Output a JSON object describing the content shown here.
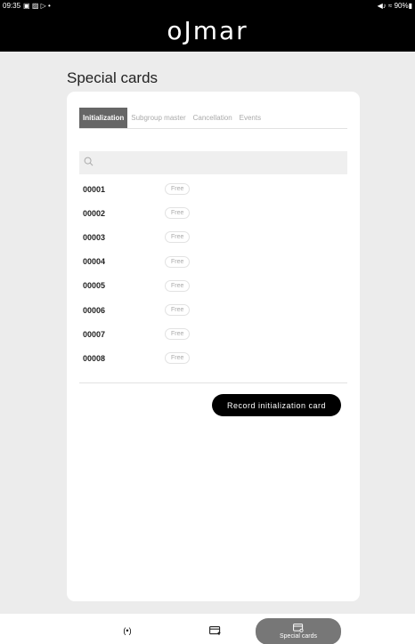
{
  "status_bar": {
    "time": "09:35",
    "left_icons": "▣ ▨ ▷ •",
    "right_text": "◀♪ ≈ 90%▮"
  },
  "brand": {
    "logo_text": "oJmar"
  },
  "page": {
    "title": "Special cards"
  },
  "tabs": [
    {
      "label": "Initialization",
      "active": true
    },
    {
      "label": "Subgroup master",
      "active": false
    },
    {
      "label": "Cancellation",
      "active": false
    },
    {
      "label": "Events",
      "active": false
    }
  ],
  "search": {
    "placeholder": "",
    "value": ""
  },
  "cards": [
    {
      "code": "00001",
      "status": "Free"
    },
    {
      "code": "00002",
      "status": "Free"
    },
    {
      "code": "00003",
      "status": "Free"
    },
    {
      "code": "00004",
      "status": "Free"
    },
    {
      "code": "00005",
      "status": "Free"
    },
    {
      "code": "00006",
      "status": "Free"
    },
    {
      "code": "00007",
      "status": "Free"
    },
    {
      "code": "00008",
      "status": "Free"
    }
  ],
  "actions": {
    "record_label": "Record initialization card"
  },
  "bottom_nav": {
    "item1_icon": "(•)",
    "item3_label": "Special cards"
  },
  "colors": {
    "status_bar_bg": "#000000",
    "page_bg": "#ececec",
    "active_tab_bg": "#666666",
    "primary_button_bg": "#000000",
    "active_nav_bg": "#777777"
  }
}
